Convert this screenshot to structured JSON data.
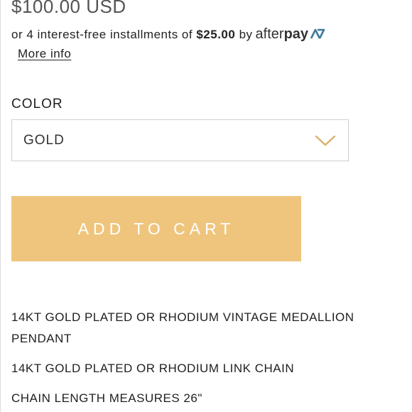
{
  "product": {
    "price": "$100.00 USD",
    "installments": {
      "prefix": "or 4 interest-free installments of",
      "amount": "$25.00",
      "by": "by",
      "provider_logo_text_after": "after",
      "provider_logo_text_pay": "pay",
      "provider_icon": "afterpay-arrows-icon"
    },
    "more_info_label": "More info"
  },
  "options": {
    "color_label": "COLOR",
    "color_selected": "GOLD",
    "chevron_icon": "chevron-down-icon"
  },
  "actions": {
    "add_to_cart_label": "ADD TO CART"
  },
  "description": {
    "lines": [
      "14KT GOLD PLATED OR RHODIUM VINTAGE MEDALLION PENDANT",
      "14KT GOLD PLATED OR RHODIUM LINK CHAIN",
      "CHAIN LENGTH MEASURES 26\""
    ]
  },
  "colors": {
    "button_background": "#efc57d",
    "button_text": "#ffffff",
    "chevron": "#d9b06a",
    "select_border": "#cfcfcf",
    "price_text": "#555555"
  }
}
